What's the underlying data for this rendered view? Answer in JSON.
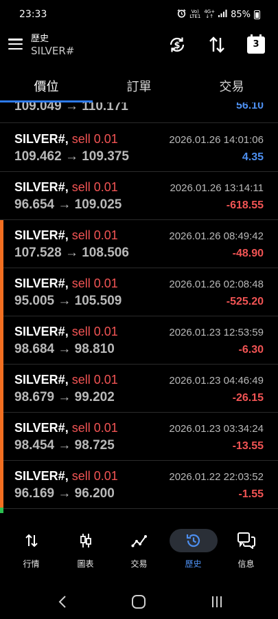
{
  "status_bar": {
    "time": "23:33",
    "volte_top": "Vo)",
    "volte_bottom": "LTE1",
    "network_top": "4G+",
    "network_bottom": "↓↑",
    "battery": "85%"
  },
  "header": {
    "title": "歷史",
    "subtitle": "SILVER#",
    "calendar_day": "3"
  },
  "tabs": [
    {
      "label": "價位",
      "active": true
    },
    {
      "label": "訂單",
      "active": false
    },
    {
      "label": "交易",
      "active": false
    }
  ],
  "partial_row": {
    "prices": "109.049 → 110.171",
    "pl": "56.10"
  },
  "trades": [
    {
      "symbol": "SILVER#,",
      "side": "sell 0.01",
      "datetime": "2026.01.26 14:01:06",
      "prices": "109.462 → 109.375",
      "pl": "4.35",
      "pl_sign": "pos",
      "marker": false
    },
    {
      "symbol": "SILVER#,",
      "side": "sell 0.01",
      "datetime": "2026.01.26 13:14:11",
      "prices": "96.654 → 109.025",
      "pl": "-618.55",
      "pl_sign": "neg",
      "marker": false
    },
    {
      "symbol": "SILVER#,",
      "side": "sell 0.01",
      "datetime": "2026.01.26 08:49:42",
      "prices": "107.528 → 108.506",
      "pl": "-48.90",
      "pl_sign": "neg",
      "marker": true
    },
    {
      "symbol": "SILVER#,",
      "side": "sell 0.01",
      "datetime": "2026.01.26 02:08:48",
      "prices": "95.005 → 105.509",
      "pl": "-525.20",
      "pl_sign": "neg",
      "marker": true
    },
    {
      "symbol": "SILVER#,",
      "side": "sell 0.01",
      "datetime": "2026.01.23 12:53:59",
      "prices": "98.684 → 98.810",
      "pl": "-6.30",
      "pl_sign": "neg",
      "marker": true
    },
    {
      "symbol": "SILVER#,",
      "side": "sell 0.01",
      "datetime": "2026.01.23 04:46:49",
      "prices": "98.679 → 99.202",
      "pl": "-26.15",
      "pl_sign": "neg",
      "marker": true
    },
    {
      "symbol": "SILVER#,",
      "side": "sell 0.01",
      "datetime": "2026.01.23 03:34:24",
      "prices": "98.454 → 98.725",
      "pl": "-13.55",
      "pl_sign": "neg",
      "marker": true
    },
    {
      "symbol": "SILVER#,",
      "side": "sell 0.01",
      "datetime": "2026.01.22 22:03:52",
      "prices": "96.169 → 96.200",
      "pl": "-1.55",
      "pl_sign": "neg",
      "marker": true
    }
  ],
  "bottom_nav": [
    {
      "label": "行情",
      "icon": "sort-arrows-icon",
      "active": false
    },
    {
      "label": "圖表",
      "icon": "candlestick-icon",
      "active": false
    },
    {
      "label": "交易",
      "icon": "trend-line-icon",
      "active": false
    },
    {
      "label": "歷史",
      "icon": "history-icon",
      "active": true
    },
    {
      "label": "信息",
      "icon": "chat-bubbles-icon",
      "active": false
    }
  ],
  "colors": {
    "accent": "#4d8ff0",
    "loss": "#f25454",
    "profit": "#4d8ff0",
    "marker": "#f36f21",
    "tab_underline": "#2d7bf0"
  }
}
